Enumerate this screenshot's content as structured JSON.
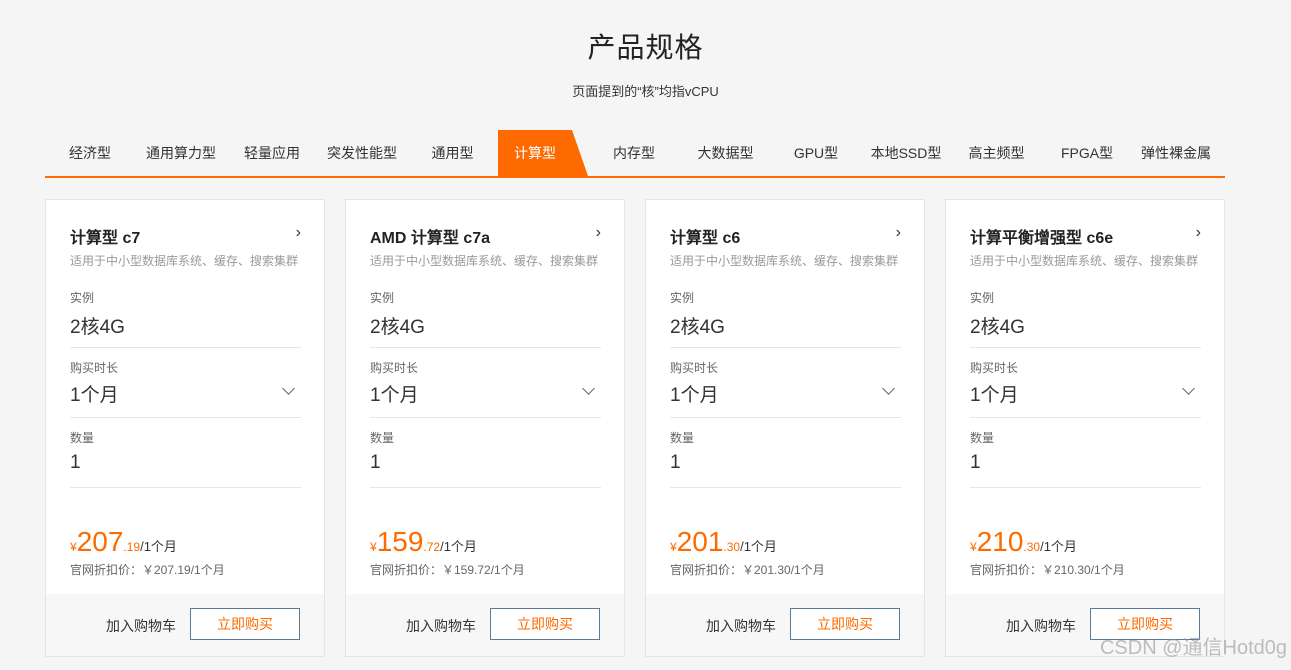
{
  "header": {
    "title": "产品规格",
    "subtitle": "页面提到的“核”均指vCPU"
  },
  "tabs": [
    {
      "label": "经济型"
    },
    {
      "label": "通用算力型"
    },
    {
      "label": "轻量应用"
    },
    {
      "label": "突发性能型"
    },
    {
      "label": "通用型"
    },
    {
      "label": "计算型",
      "active": true
    },
    {
      "label": "内存型"
    },
    {
      "label": "大数据型"
    },
    {
      "label": "GPU型"
    },
    {
      "label": "本地SSD型"
    },
    {
      "label": "高主频型"
    },
    {
      "label": "FPGA型"
    },
    {
      "label": "弹性裸金属"
    }
  ],
  "field_labels": {
    "instance": "实例",
    "duration": "购买时长",
    "quantity": "数量"
  },
  "cards": [
    {
      "title": "计算型 c7",
      "desc": "适用于中小型数据库系统、缓存、搜索集群",
      "instance": "2核4G",
      "duration": "1个月",
      "quantity": "1",
      "currency": "¥",
      "price_int": "207",
      "price_dec": ".19",
      "price_unit": "/1个月",
      "orig_price": "官网折扣价：￥207.19/1个月",
      "cart_label": "加入购物车",
      "buy_label": "立即购买"
    },
    {
      "title": "AMD 计算型 c7a",
      "desc": "适用于中小型数据库系统、缓存、搜索集群",
      "instance": "2核4G",
      "duration": "1个月",
      "quantity": "1",
      "currency": "¥",
      "price_int": "159",
      "price_dec": ".72",
      "price_unit": "/1个月",
      "orig_price": "官网折扣价：￥159.72/1个月",
      "cart_label": "加入购物车",
      "buy_label": "立即购买"
    },
    {
      "title": "计算型 c6",
      "desc": "适用于中小型数据库系统、缓存、搜索集群",
      "instance": "2核4G",
      "duration": "1个月",
      "quantity": "1",
      "currency": "¥",
      "price_int": "201",
      "price_dec": ".30",
      "price_unit": "/1个月",
      "orig_price": "官网折扣价：￥201.30/1个月",
      "cart_label": "加入购物车",
      "buy_label": "立即购买"
    },
    {
      "title": "计算平衡增强型 c6e",
      "desc": "适用于中小型数据库系统、缓存、搜索集群",
      "instance": "2核4G",
      "duration": "1个月",
      "quantity": "1",
      "currency": "¥",
      "price_int": "210",
      "price_dec": ".30",
      "price_unit": "/1个月",
      "orig_price": "官网折扣价：￥210.30/1个月",
      "cart_label": "加入购物车",
      "buy_label": "立即购买"
    }
  ],
  "icons": {
    "card_arrow": "chevron-right-icon",
    "duration_dropdown": "chevron-down-icon"
  },
  "colors": {
    "accent": "#ff6a00",
    "background": "#f5f5f6"
  },
  "watermark": "CSDN @通信Hotd0g"
}
